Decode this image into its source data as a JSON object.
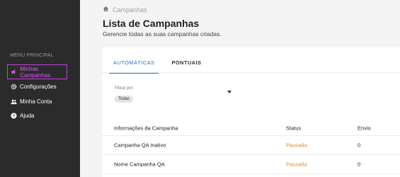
{
  "sidebar": {
    "heading": "MENU PRINCIPAL",
    "items": [
      {
        "label": "Minhas Campanhas",
        "icon": "megaphone-icon",
        "active": true
      },
      {
        "label": "Configurações",
        "icon": "gear-icon",
        "active": false
      },
      {
        "label": "Minha Conta",
        "icon": "people-icon",
        "active": false
      },
      {
        "label": "Ajuda",
        "icon": "help-icon",
        "active": false
      }
    ]
  },
  "breadcrumb": {
    "icon": "home-icon",
    "label": "Campanhas"
  },
  "page": {
    "title": "Lista de Campanhas",
    "subtitle": "Gerencie todas as suas campanhas criadas."
  },
  "tabs": [
    {
      "label": "AUTOMÁTICAS",
      "active": true
    },
    {
      "label": "PONTUAIS",
      "active": false
    }
  ],
  "filter": {
    "label": "Filtrar por",
    "value": "Todas"
  },
  "table": {
    "headers": [
      "Informações da Campanha",
      "Status",
      "Envio"
    ],
    "rows": [
      {
        "name": "Campanha QA Inativo",
        "status": "Pausada",
        "envio": "0"
      },
      {
        "name": "Nome Campanha QA",
        "status": "Pausada",
        "envio": "0"
      }
    ]
  },
  "colors": {
    "accent": "#2a74c9",
    "active_nav": "#c43fe0",
    "status_paused": "#e08a28",
    "sidebar_bg": "#2b2b2b"
  }
}
